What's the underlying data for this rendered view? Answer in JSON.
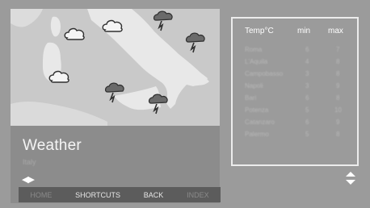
{
  "panel": {
    "title": "Weather",
    "subtitle": "Italy"
  },
  "navbar": {
    "home": "HOME",
    "shortcuts": "SHORTCUTS",
    "back": "BACK",
    "index": "INDEX"
  },
  "table": {
    "headers": {
      "temp": "Temp°C",
      "min": "min",
      "max": "max"
    },
    "rows": [
      {
        "city": "Roma",
        "min": "6",
        "max": "7"
      },
      {
        "city": "L'Aquila",
        "min": "4",
        "max": "8"
      },
      {
        "city": "Campobasso",
        "min": "3",
        "max": "8"
      },
      {
        "city": "Napoli",
        "min": "3",
        "max": "9"
      },
      {
        "city": "Bari",
        "min": "6",
        "max": "8"
      },
      {
        "city": "Potenza",
        "min": "5",
        "max": "10"
      },
      {
        "city": "Catanzaro",
        "min": "6",
        "max": "9"
      },
      {
        "city": "Palermo",
        "min": "5",
        "max": "8"
      }
    ]
  },
  "icons": {
    "weather": [
      "cloud-icon",
      "rain-cloud-icon"
    ],
    "nav_lr": "left-right-arrows-icon",
    "nav_ud": "up-down-arrows-icon"
  },
  "colors": {
    "background": "#9b9b9b",
    "map_sea": "#c9c9c9",
    "land": "#e8e8e8",
    "panel": "#8c8c8c",
    "navbar": "#5c5c5c"
  }
}
